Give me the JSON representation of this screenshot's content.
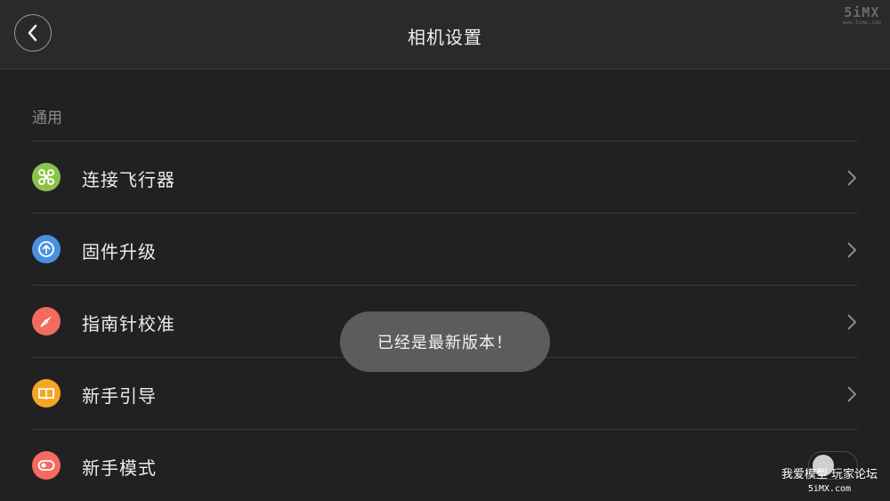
{
  "header": {
    "title": "相机设置",
    "back_icon": "chevron-left-icon",
    "watermark_logo": "5iMX",
    "watermark_url": "www.5imx.com"
  },
  "section": {
    "label": "通用"
  },
  "items": [
    {
      "label": "连接飞行器",
      "icon": "drone-icon",
      "icon_color": "#8bc34a",
      "control": "chevron"
    },
    {
      "label": "固件升级",
      "icon": "upgrade-icon",
      "icon_color": "#4a90e2",
      "control": "chevron"
    },
    {
      "label": "指南针校准",
      "icon": "compass-icon",
      "icon_color": "#f36b5f",
      "control": "chevron"
    },
    {
      "label": "新手引导",
      "icon": "book-icon",
      "icon_color": "#f5a623",
      "control": "chevron"
    },
    {
      "label": "新手模式",
      "icon": "toggle-mode-icon",
      "icon_color": "#f36b5f",
      "control": "toggle",
      "toggle_on": false
    }
  ],
  "toast": {
    "message": "已经是最新版本！"
  },
  "footer_watermark": {
    "line1": "我爱模型 玩家论坛",
    "line2": "5iMX.com"
  }
}
